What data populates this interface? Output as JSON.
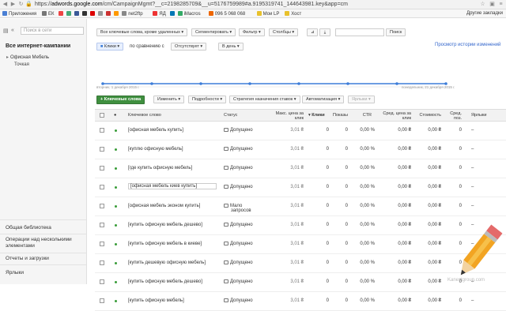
{
  "browser": {
    "url_prefix": "https://",
    "url_host": "adwords.google.com",
    "url_path": "/cm/CampaignMgmt?__c=2198285709&__u=5176759989#a.9195319741_144643981.key&app=cm",
    "bookmarks": [
      {
        "label": "Приложения",
        "color": "#4a7fd4"
      },
      {
        "label": "ЕК",
        "color": "#777"
      },
      {
        "label": "",
        "color": "#e44"
      },
      {
        "label": "",
        "color": "#4a7"
      },
      {
        "label": "",
        "color": "#3b5998"
      },
      {
        "label": "",
        "color": "#333"
      },
      {
        "label": "",
        "color": "#d00"
      },
      {
        "label": "",
        "color": "#999"
      },
      {
        "label": "",
        "color": "#c33"
      },
      {
        "label": "",
        "color": "#f90"
      },
      {
        "label": "net2ftp",
        "color": "#888"
      },
      {
        "label": "ЯД",
        "color": "#e33"
      },
      {
        "label": "",
        "color": "#0077b5"
      },
      {
        "label": "iMacros",
        "color": "#3a6"
      },
      {
        "label": "096 5 068 068",
        "color": "#e60"
      },
      {
        "label": "Мои LP",
        "color": "#e8c12c"
      },
      {
        "label": "Хост",
        "color": "#e8c12c"
      }
    ],
    "other_bookmarks": "Другие закладки"
  },
  "sidebar": {
    "search_placeholder": "Поиск в сети",
    "heading": "Все интернет-кампании",
    "campaign": "Офисная Мебель",
    "adgroup": "Точкая",
    "bottom_items": [
      "Общая библиотека",
      "Операции над несколькими элементами",
      "Отчеты и загрузки",
      "Ярлыки"
    ]
  },
  "toolbar": {
    "status_filter": "Все ключевые слова, кроме удаленных",
    "segment": "Сегментировать",
    "filter": "Фильтр",
    "columns": "Столбцы",
    "search_button": "Поиск",
    "history_link": "Просмотр истории изменений",
    "metric": "Клики",
    "compare_label": "по сравнению с",
    "compare_value": "Отсутствует",
    "period": "В день"
  },
  "chart_data": {
    "type": "line",
    "x_start_label": "вторник, 1 декабря 2015 г.",
    "x_end_label": "понедельник, 21 декабря 2015 г.",
    "values": [
      0,
      0,
      0,
      0,
      0,
      0,
      0,
      0
    ],
    "color": "#3d7dd8"
  },
  "actions": {
    "add_keywords": "+ Ключевые слова",
    "edit": "Изменить",
    "details": "Подробности",
    "bid_strategy": "Стратегия назначения ставок",
    "automation": "Автоматизация",
    "labels": "Ярлыки"
  },
  "table": {
    "headers": {
      "keyword": "Ключевое слово",
      "status": "Статус",
      "max_cpc": "Макс. цена за клик",
      "clicks": "Клики",
      "impressions": "Показы",
      "ctr": "CTR",
      "avg_cpc": "Сред. цена за клик",
      "cost": "Стоимость",
      "avg_pos": "Сред. поз.",
      "labels": "Ярлыки"
    },
    "rows": [
      {
        "keyword": "[офисная мебель купить]",
        "status": "Допущено",
        "status2": "",
        "bid": "3,01 ₴",
        "clicks": "0",
        "impr": "0",
        "ctr": "0,00 %",
        "avg_cpc": "0,00 ₴",
        "cost": "0,00 ₴",
        "pos": "0",
        "labels": "–"
      },
      {
        "keyword": "[куплю офисную мебель]",
        "status": "Допущено",
        "status2": "",
        "bid": "3,01 ₴",
        "clicks": "0",
        "impr": "0",
        "ctr": "0,00 %",
        "avg_cpc": "0,00 ₴",
        "cost": "0,00 ₴",
        "pos": "0",
        "labels": "–"
      },
      {
        "keyword": "[где купить офисную мебель]",
        "status": "Допущено",
        "status2": "",
        "bid": "3,01 ₴",
        "clicks": "0",
        "impr": "0",
        "ctr": "0,00 %",
        "avg_cpc": "0,00 ₴",
        "cost": "0,00 ₴",
        "pos": "0",
        "labels": "–"
      },
      {
        "keyword": "[офисная мебель киев купить]",
        "status": "Допущено",
        "status2": "",
        "bid": "3,01 ₴",
        "clicks": "0",
        "impr": "0",
        "ctr": "0,00 %",
        "avg_cpc": "0,00 ₴",
        "cost": "0,00 ₴",
        "pos": "0",
        "labels": "–"
      },
      {
        "keyword": "[офисная мебель эконом купить]",
        "status": "Мало",
        "status2": "запросов",
        "bid": "3,01 ₴",
        "clicks": "0",
        "impr": "0",
        "ctr": "0,00 %",
        "avg_cpc": "0,00 ₴",
        "cost": "0,00 ₴",
        "pos": "0",
        "labels": "–"
      },
      {
        "keyword": "[купить офисную мебель дешево]",
        "status": "Допущено",
        "status2": "",
        "bid": "3,01 ₴",
        "clicks": "0",
        "impr": "0",
        "ctr": "0,00 %",
        "avg_cpc": "0,00 ₴",
        "cost": "0,00 ₴",
        "pos": "0",
        "labels": "–"
      },
      {
        "keyword": "[купить офисную мебель в киеве]",
        "status": "Допущено",
        "status2": "",
        "bid": "3,01 ₴",
        "clicks": "0",
        "impr": "0",
        "ctr": "0,00 %",
        "avg_cpc": "0,00 ₴",
        "cost": "0,00 ₴",
        "pos": "0",
        "labels": "–"
      },
      {
        "keyword": "[купить дешевую офисную мебель]",
        "status": "Допущено",
        "status2": "",
        "bid": "3,01 ₴",
        "clicks": "0",
        "impr": "0",
        "ctr": "0,00 %",
        "avg_cpc": "0,00 ₴",
        "cost": "0,00 ₴",
        "pos": "0",
        "labels": "–"
      },
      {
        "keyword": "[купить офисную мебель дешево]",
        "status": "Допущено",
        "status2": "",
        "bid": "3,01 ₴",
        "clicks": "0",
        "impr": "0",
        "ctr": "0,00 %",
        "avg_cpc": "0,00 ₴",
        "cost": "0,00 ₴",
        "pos": "0",
        "labels": "–"
      },
      {
        "keyword": "[купить офисную мебель]",
        "status": "Допущено",
        "status2": "",
        "bid": "3,01 ₴",
        "clicks": "0",
        "impr": "0",
        "ctr": "0,00 %",
        "avg_cpc": "0,00 ₴",
        "cost": "0,00 ₴",
        "pos": "0",
        "labels": "–"
      }
    ]
  },
  "watermark": "Kanestgroup.com"
}
